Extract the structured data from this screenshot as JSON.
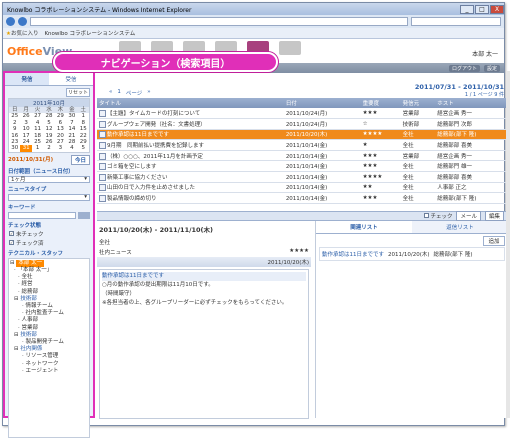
{
  "window": {
    "title": "Knowlbo コラボレーションシステム - Windows Internet Explorer",
    "min": "_",
    "max": "□",
    "close": "X"
  },
  "favbar": {
    "favorites": "お気に入り",
    "tab": "Knowlbo コラボレーションシステム"
  },
  "header": {
    "logo_a": "Office",
    "logo_b": "View",
    "user": "本部 太一"
  },
  "callout": "ナビゲーション（検索項目）",
  "toolbar": {
    "btn1": "ログアウト",
    "btn2": "設定"
  },
  "left": {
    "tab_send": "発信",
    "tab_recv": "受信",
    "reset": "リセット",
    "cal": {
      "title": "2011年10月",
      "days": [
        "日",
        "月",
        "火",
        "水",
        "木",
        "金",
        "土"
      ],
      "dates": [
        "25",
        "26",
        "27",
        "28",
        "29",
        "30",
        "1",
        "2",
        "3",
        "4",
        "5",
        "6",
        "7",
        "8",
        "9",
        "10",
        "11",
        "12",
        "13",
        "14",
        "15",
        "16",
        "17",
        "18",
        "19",
        "20",
        "21",
        "22",
        "23",
        "24",
        "25",
        "26",
        "27",
        "28",
        "29",
        "30",
        "31",
        "1",
        "2",
        "3",
        "4",
        "5"
      ],
      "today": "31",
      "today_label": "今日"
    },
    "date_text": "2011/10/31(月)",
    "date_label": "日付範囲（ニュース日付）",
    "range": "1ヶ月",
    "type_label": "ニュースタイプ",
    "kw_label": "キーワード",
    "kw_btn": "検索",
    "chk_label": "チェック状態",
    "chk1": "未チェック",
    "chk2": "チェック済",
    "tree_label": "テクニカル・スタッフ",
    "tree": [
      "本部 太一",
      "「本部 太一」",
      "全社",
      "経営",
      "総務部",
      "技術部",
      "情報チーム",
      "社内監査チーム",
      "人事部",
      "営業部",
      "技術部",
      "製品開発チーム",
      "社内関係",
      "リソース管理",
      "ネットワーク",
      "エージェント"
    ]
  },
  "main": {
    "range": "2011/07/31 - 2011/10/31",
    "pager": {
      "prev": "«",
      "page": "1",
      "label": "ページ",
      "next": "»"
    },
    "pager2": "1 / 1 ページ  9 件",
    "cols": [
      "タイトル",
      "日付",
      "重要度",
      "発信元",
      "ホスト"
    ],
    "rows": [
      {
        "title": "【主題】タイムカードの打刻について",
        "date": "2011/10/24(月)",
        "imp": "★★★",
        "from": "営業部",
        "host": "経営企画 秀一"
      },
      {
        "title": "グループウェア開発（社名：文書処理）",
        "date": "2011/10/24(月)",
        "imp": "☆",
        "from": "技術部",
        "host": "総務部門 次郎"
      },
      {
        "title": "動作承認は11日までです",
        "date": "2011/10/20(木)",
        "imp": "★★★★",
        "from": "全社",
        "host": "総務部(部下 隆)"
      },
      {
        "title": "9月期　同期前払い提携費を記録します",
        "date": "2011/10/14(金)",
        "imp": "★",
        "from": "全社",
        "host": "総務部部 喜美"
      },
      {
        "title": "（株）○○○、2011年11月を計画予定",
        "date": "2011/10/14(金)",
        "imp": "★★★",
        "from": "営業部",
        "host": "経営企画 秀一"
      },
      {
        "title": "ゴミ箱を空にします",
        "date": "2011/10/14(金)",
        "imp": "★★★",
        "from": "全社",
        "host": "総務部門 雄一"
      },
      {
        "title": "新築工事に協力ください",
        "date": "2011/10/14(金)",
        "imp": "★★★★",
        "from": "全社",
        "host": "総務部部 喜美"
      },
      {
        "title": "山田の日で入力件を止めさせました",
        "date": "2011/10/14(金)",
        "imp": "★★",
        "from": "全社",
        "host": "人事部 正之"
      },
      {
        "title": "製品情報の締め切り",
        "date": "2011/10/14(金)",
        "imp": "★★★",
        "from": "全社",
        "host": "総務部(部下 隆)"
      }
    ],
    "bar": {
      "check": "チェック",
      "mail": "メール",
      "edit": "編集"
    },
    "detail": {
      "title": "2011/10/20(木) - 2011/11/10(木)",
      "org": "全社",
      "kind": "社内ニュース",
      "stars": "★★★★",
      "head": "動作承認は11日までです",
      "date": "2011/10/20(木)",
      "link": "動作承認は11日までです",
      "body1": "○月の動作承認の提出期限は11月10日です。",
      "body2": "（時間厳守）",
      "body3": "※各担当者の上、各グループリーダーに必ずチェックをもらってください。"
    },
    "side": {
      "tab1": "関連リスト",
      "tab2": "返信リスト",
      "add": "追加",
      "item_title": "動作承認は11日までです",
      "item_date": "2011/10/20(木)",
      "item_host": "総務部(部下 隆)"
    }
  }
}
